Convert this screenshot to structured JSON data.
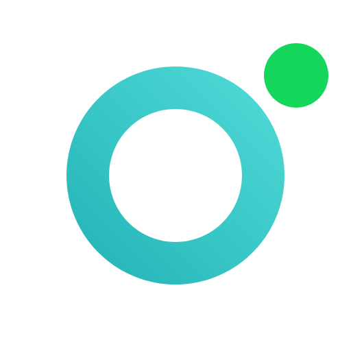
{
  "logo": {
    "ring_color_light": "#4ED8D6",
    "ring_color_dark": "#26B6B8",
    "dot_color": "#13D65A",
    "background": "#FFFFFF",
    "ring_icon": "ring-icon",
    "dot_icon": "status-dot-icon"
  }
}
